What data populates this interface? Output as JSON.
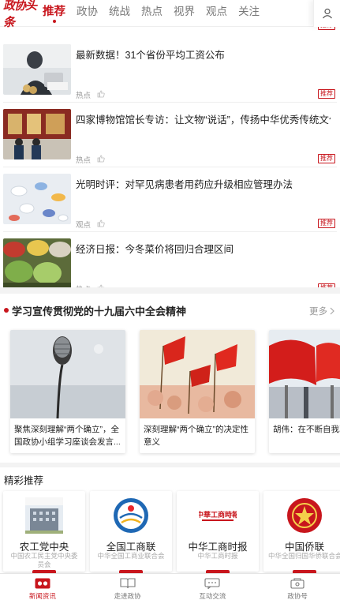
{
  "nav": {
    "brand": "政协头条",
    "tabs": [
      {
        "label": "推荐",
        "active": true
      },
      {
        "label": "政协"
      },
      {
        "label": "统战"
      },
      {
        "label": "热点"
      },
      {
        "label": "视界"
      },
      {
        "label": "观点"
      },
      {
        "label": "关注"
      }
    ],
    "user_icon": "user-icon"
  },
  "news": [
    {
      "title": "最新数据！31个省份平均工资公布",
      "category": "热点",
      "tag": "推荐"
    },
    {
      "title": "四家博物馆馆长专访：让文物“说话”，传扬中华优秀传统文化",
      "category": "热点",
      "tag": "推荐"
    },
    {
      "title": "光明时评：对罕见病患者用药应升级相应管理办法",
      "category": "观点",
      "tag": "推荐"
    },
    {
      "title": "经济日报：今冬菜价将回归合理区间",
      "category": "热点",
      "tag": "推荐"
    }
  ],
  "topic": {
    "title": "学习宣传贯彻党的十九届六中全会精神",
    "more": "更多",
    "cards": [
      {
        "title": "聚焦深刻理解“两个确立”，全国政协小组学习座谈会发言..."
      },
      {
        "title": "深刻理解“两个确立”的决定性意义"
      },
      {
        "title": "胡伟：在不断自我革"
      }
    ]
  },
  "recommend": {
    "title": "精彩推荐",
    "cards": [
      {
        "name": "农工党中央",
        "desc": "中国农工民主党中央委员会",
        "logo_text": "中国农工民主党"
      },
      {
        "name": "全国工商联",
        "desc": "中华全国工商业联合会"
      },
      {
        "name": "中华工商时报",
        "desc": "中华工商时报",
        "logo_text": "中華工商時報"
      },
      {
        "name": "中国侨联",
        "desc": "中华全国归国华侨联合会"
      }
    ]
  },
  "bottom_tabs": [
    {
      "label": "新闻资讯",
      "active": true
    },
    {
      "label": "走进政协"
    },
    {
      "label": "互动交流"
    },
    {
      "label": "政协号"
    }
  ],
  "colors": {
    "accent": "#c8161d"
  }
}
